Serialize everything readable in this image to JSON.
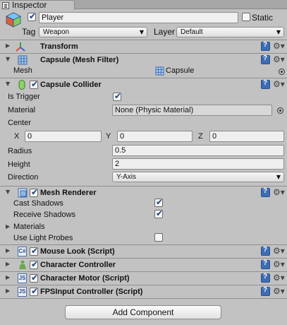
{
  "window": {
    "tab_title": "Inspector"
  },
  "object": {
    "name": "Player",
    "active": true,
    "static_label": "Static",
    "static_checked": false,
    "tag_label": "Tag",
    "tag_value": "Weapon",
    "layer_label": "Layer",
    "layer_value": "Default"
  },
  "components": {
    "transform": {
      "title": "Transform"
    },
    "mesh_filter": {
      "title": "Capsule (Mesh Filter)",
      "mesh_label": "Mesh",
      "mesh_value": "Capsule"
    },
    "capsule_collider": {
      "title": "Capsule Collider",
      "enabled": true,
      "is_trigger_label": "Is Trigger",
      "is_trigger": true,
      "material_label": "Material",
      "material_value": "None (Physic Material)",
      "center_label": "Center",
      "x_label": "X",
      "x_value": "0",
      "y_label": "Y",
      "y_value": "0",
      "z_label": "Z",
      "z_value": "0",
      "radius_label": "Radius",
      "radius_value": "0.5",
      "height_label": "Height",
      "height_value": "2",
      "direction_label": "Direction",
      "direction_value": "Y-Axis"
    },
    "mesh_renderer": {
      "title": "Mesh Renderer",
      "enabled": true,
      "cast_shadows_label": "Cast Shadows",
      "cast_shadows": true,
      "receive_shadows_label": "Receive Shadows",
      "receive_shadows": true,
      "materials_label": "Materials",
      "use_light_probes_label": "Use Light Probes",
      "use_light_probes": false
    },
    "mouse_look": {
      "title": "Mouse Look (Script)",
      "enabled": true,
      "icon_text": "C#"
    },
    "character_controller": {
      "title": "Character Controller",
      "enabled": true
    },
    "character_motor": {
      "title": "Character Motor (Script)",
      "enabled": true,
      "icon_text": "JS"
    },
    "fps_input": {
      "title": "FPSInput Controller (Script)",
      "enabled": true,
      "icon_text": "JS"
    }
  },
  "add_component_label": "Add Component",
  "icons": {
    "fold_expanded": "▼",
    "fold_collapsed": "▶",
    "dropdown_arrow": "▼",
    "gear": "⚙▾"
  }
}
